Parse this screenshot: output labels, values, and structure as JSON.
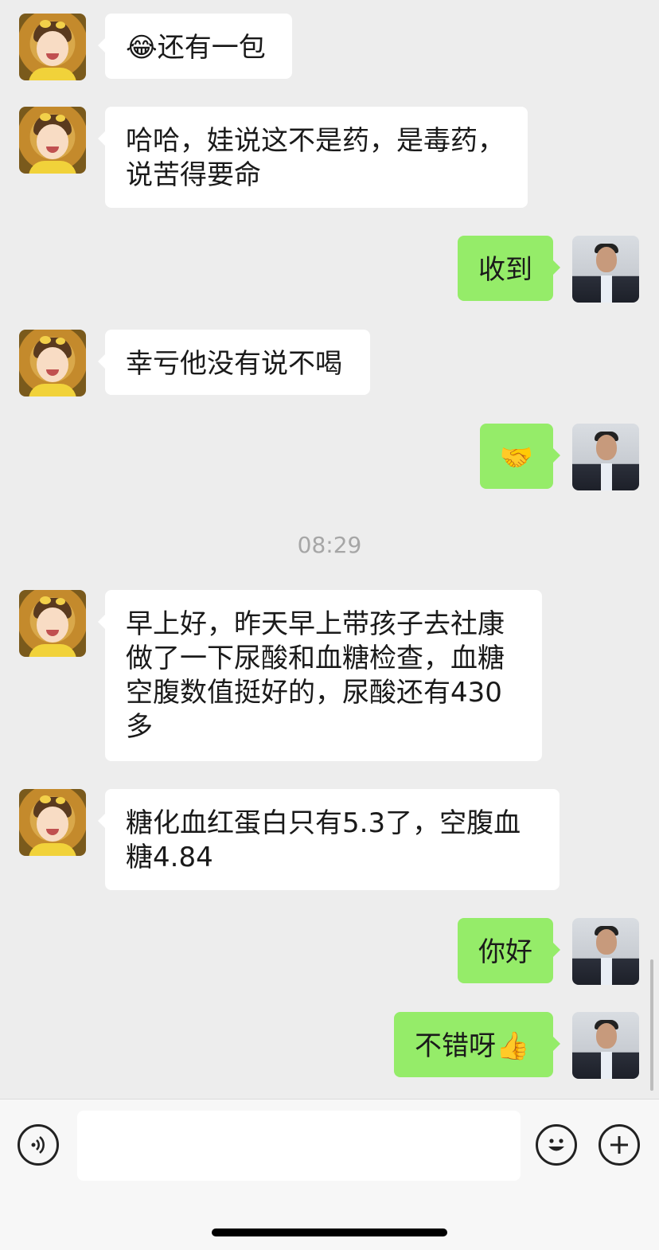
{
  "messages": [
    {
      "side": "left",
      "avatar": "baby-avatar",
      "emoji": "😂",
      "text": "还有一包"
    },
    {
      "side": "left",
      "avatar": "baby-avatar",
      "text": "哈哈，娃说这不是药，是毒药，说苦得要命"
    },
    {
      "side": "right",
      "avatar": "man-avatar",
      "text": "收到"
    },
    {
      "side": "left",
      "avatar": "baby-avatar",
      "text": "幸亏他没有说不喝"
    },
    {
      "side": "right",
      "avatar": "man-avatar",
      "emoji": "🤝",
      "text": ""
    },
    {
      "side": "left",
      "avatar": "baby-avatar",
      "text": "早上好，昨天早上带孩子去社康做了一下尿酸和血糖检查，血糖空腹数值挺好的，尿酸还有430多"
    },
    {
      "side": "left",
      "avatar": "baby-avatar",
      "text": "糖化血红蛋白只有5.3了，空腹血糖4.84"
    },
    {
      "side": "right",
      "avatar": "man-avatar",
      "text": "你好"
    },
    {
      "side": "right",
      "avatar": "man-avatar",
      "text": "不错呀",
      "emoji": "👍"
    }
  ],
  "timestamp": "08:29",
  "input": {
    "value": "",
    "placeholder": ""
  },
  "icons": {
    "voice": "voice-icon",
    "emoji": "emoji-icon",
    "plus": "plus-icon"
  },
  "colors": {
    "background": "#ededed",
    "bubble_self": "#95ec69",
    "bubble_other": "#ffffff",
    "timestamp": "#a6a6a6"
  }
}
